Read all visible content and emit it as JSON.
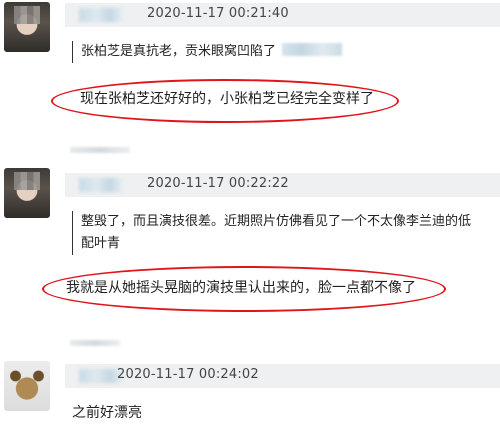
{
  "comments": [
    {
      "timestamp": "2020-11-17 00:21:40",
      "quote": "张柏芝是真抗老，贡米眼窝凹陷了",
      "reply": "现在张柏芝还好好的，小张柏芝已经完全变样了"
    },
    {
      "timestamp": "2020-11-17 00:22:22",
      "quote_line1": "整毁了，而且演技很差。近期照片仿佛看见了一个不太像李兰迪的低",
      "quote_line2": "配叶青",
      "reply": "我就是从她摇头晃脑的演技里认出来的，脸一点都不像了"
    },
    {
      "timestamp": "2020-11-17 00:24:02",
      "reply": "之前好漂亮"
    }
  ],
  "colors": {
    "highlight_circle": "#e0151b",
    "header_bg": "#eef0f1"
  },
  "icons": [
    "avatar-blurred",
    "username-blurred"
  ]
}
